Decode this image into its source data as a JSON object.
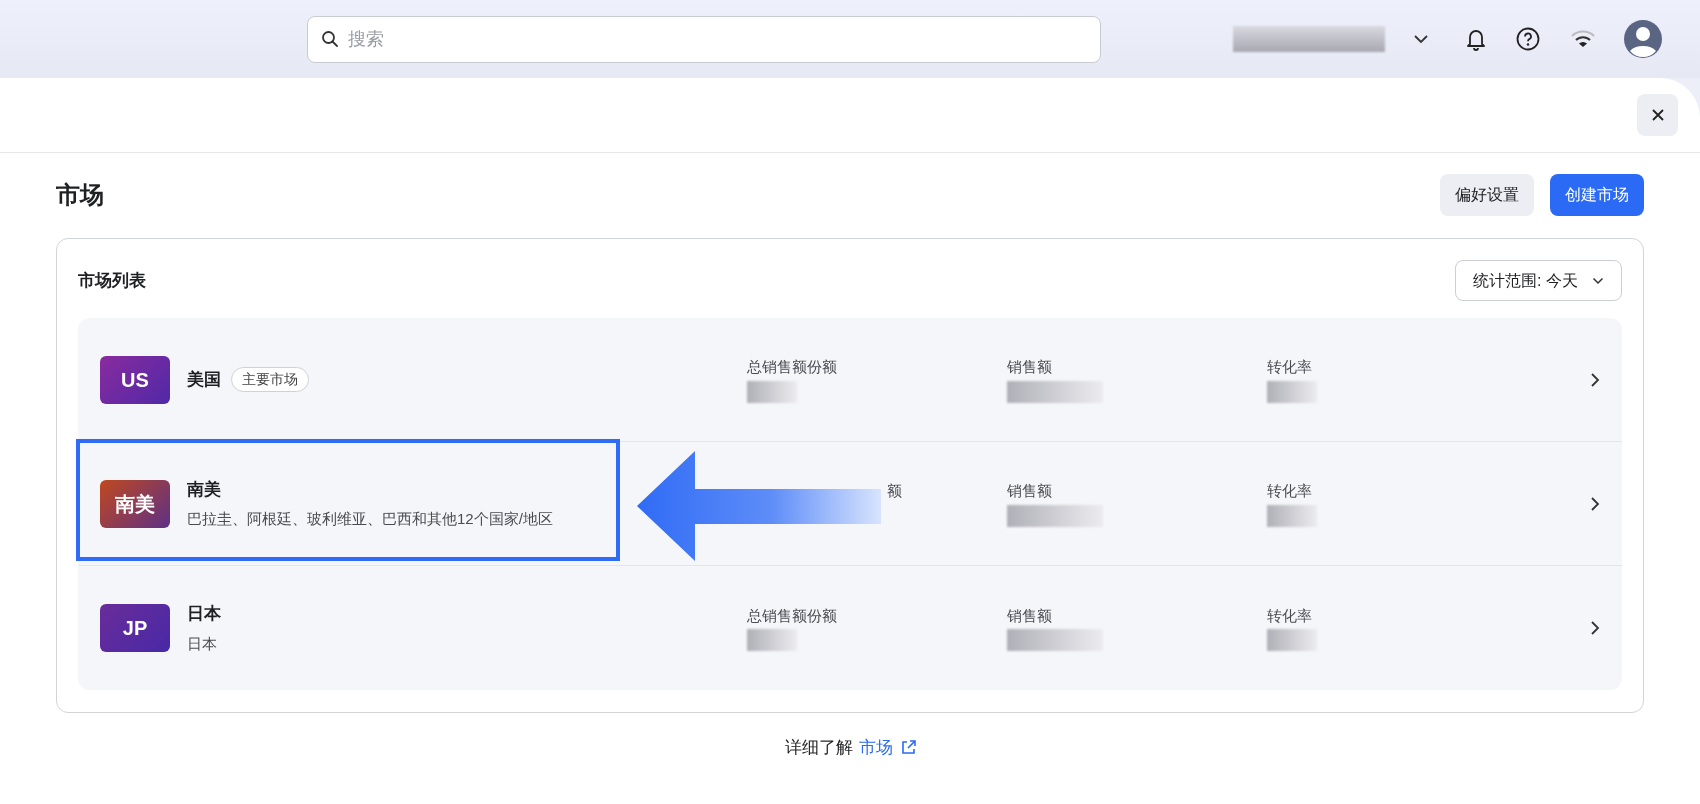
{
  "search": {
    "placeholder": "搜索"
  },
  "page": {
    "title": "市场",
    "buttons": [
      {
        "label": "偏好设置",
        "kind": "secondary"
      },
      {
        "label": "创建市场",
        "kind": "primary"
      }
    ]
  },
  "card": {
    "title": "市场列表",
    "range": "统计范围: 今天"
  },
  "markets": [
    {
      "code": "US",
      "name": "美国",
      "badge": "主要市场",
      "color": "#8a2b9e",
      "highlighted": false,
      "metrics": [
        {
          "label": "总销售额份额"
        },
        {
          "label": "销售额"
        },
        {
          "label": "转化率"
        }
      ]
    },
    {
      "code": "南美",
      "name": "南美",
      "subtitle": "巴拉圭、阿根廷、玻利维亚、巴西和其他12个国家/地区",
      "color": "#c0481e",
      "highlighted": true,
      "metrics": [
        {
          "label": "额"
        },
        {
          "label": "销售额"
        },
        {
          "label": "转化率"
        }
      ]
    },
    {
      "code": "JP",
      "name": "日本",
      "subtitle": "日本",
      "color": "#6a2c9a",
      "highlighted": false,
      "metrics": [
        {
          "label": "总销售额份额"
        },
        {
          "label": "销售额"
        },
        {
          "label": "转化率"
        }
      ]
    }
  ],
  "footer": {
    "text": "详细了解",
    "link": "市场"
  }
}
